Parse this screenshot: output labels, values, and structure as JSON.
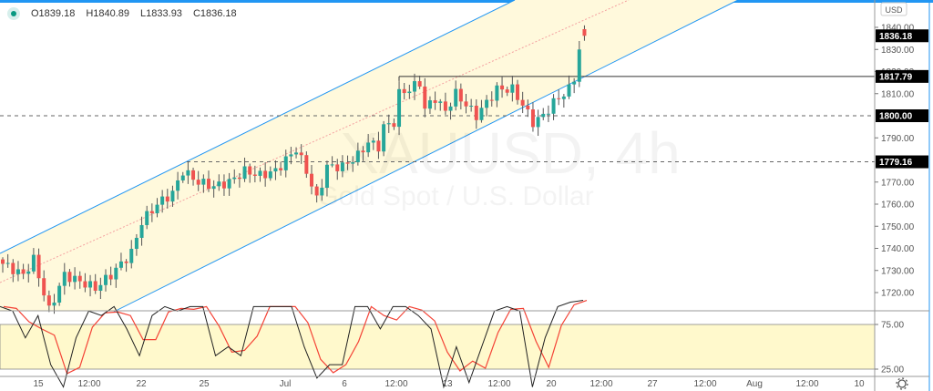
{
  "legend": {
    "open": "O1839.18",
    "high": "H1840.89",
    "low": "L1833.93",
    "close": "C1836.18"
  },
  "watermark": {
    "symbol": "XAUUSD, 4h",
    "description": "Gold Spot / U.S. Dollar"
  },
  "price_axis": {
    "currency": "USD",
    "ticks": [
      "1840.00",
      "1830.00",
      "1820.00",
      "1810.00",
      "1790.00",
      "1770.00",
      "1760.00",
      "1750.00",
      "1740.00",
      "1730.00",
      "1720.00"
    ],
    "tags": {
      "last": "1836.18",
      "resistance": "1817.79",
      "level_1800": "1800.00",
      "level_1779": "1779.16"
    }
  },
  "oscillator_axis": {
    "ticks": [
      "75.00",
      "25.00"
    ]
  },
  "time_axis": {
    "labels": [
      "15",
      "12:00",
      "22",
      "25",
      "Jul",
      "6",
      "12:00",
      "13",
      "12:00",
      "20",
      "12:00",
      "27",
      "12:00",
      "Aug",
      "12:00",
      "10"
    ]
  },
  "settings_icon": "gear-icon",
  "colors": {
    "up": "#26a69a",
    "down": "#ef5350",
    "channel": "#2196f3",
    "channel_fill": "#fff9dc",
    "mid": "#f4a0a0",
    "stoch_k": "#222222",
    "stoch_d": "#f44336"
  },
  "chart_data": {
    "type": "candlestick",
    "symbol": "XAUUSD",
    "interval": "4h",
    "ylim": [
      1712,
      1850
    ],
    "price_path": [
      [
        0,
        1733
      ],
      [
        4,
        1728
      ],
      [
        6,
        1735
      ],
      [
        9,
        1712
      ],
      [
        12,
        1728
      ],
      [
        18,
        1722
      ],
      [
        21,
        1728
      ],
      [
        25,
        1738
      ],
      [
        27,
        1752
      ],
      [
        30,
        1760
      ],
      [
        33,
        1765
      ],
      [
        35,
        1775
      ],
      [
        38,
        1770
      ],
      [
        41,
        1768
      ],
      [
        44,
        1770
      ],
      [
        47,
        1775
      ],
      [
        50,
        1773
      ],
      [
        53,
        1775
      ],
      [
        55,
        1780
      ],
      [
        57,
        1785
      ],
      [
        59,
        1775
      ],
      [
        61,
        1762
      ],
      [
        63,
        1777
      ],
      [
        66,
        1777
      ],
      [
        69,
        1782
      ],
      [
        71,
        1788
      ],
      [
        73,
        1786
      ],
      [
        74,
        1795
      ],
      [
        76,
        1797
      ],
      [
        77,
        1810
      ],
      [
        79,
        1812
      ],
      [
        81,
        1815
      ],
      [
        82,
        1803
      ],
      [
        84,
        1808
      ],
      [
        86,
        1802
      ],
      [
        88,
        1810
      ],
      [
        90,
        1805
      ],
      [
        92,
        1800
      ],
      [
        94,
        1806
      ],
      [
        96,
        1812
      ],
      [
        99,
        1812
      ],
      [
        101,
        1805
      ],
      [
        103,
        1797
      ],
      [
        105,
        1800
      ],
      [
        107,
        1806
      ],
      [
        110,
        1812
      ],
      [
        111,
        1817
      ],
      [
        112,
        1830
      ],
      [
        113,
        1836.18
      ]
    ],
    "levels": [
      1817.79,
      1800.0,
      1779.16
    ],
    "stochastic": {
      "range": [
        0,
        100
      ],
      "bands": [
        25,
        75
      ],
      "k": [
        95,
        90,
        60,
        85,
        30,
        5,
        60,
        90,
        85,
        95,
        70,
        40,
        85,
        95,
        90,
        95,
        95,
        40,
        50,
        40,
        95,
        95,
        95,
        95,
        50,
        15,
        30,
        30,
        95,
        95,
        70,
        95,
        95,
        85,
        70,
        5,
        50,
        10,
        50,
        90,
        95,
        90,
        5,
        60,
        95,
        100,
        105
      ]
    }
  }
}
